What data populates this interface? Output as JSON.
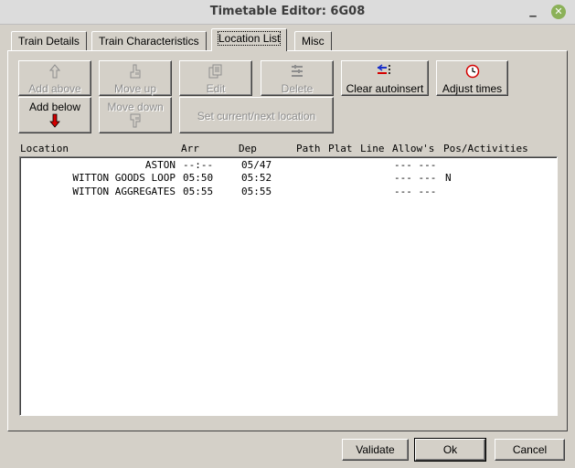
{
  "window": {
    "title": "Timetable Editor: 6G08",
    "minimize_glyph": "_",
    "close_glyph": "✕"
  },
  "tabs": [
    {
      "label": "Train Details",
      "active": false
    },
    {
      "label": "Train Characteristics",
      "active": false
    },
    {
      "label": "Location List",
      "active": true
    },
    {
      "label": "Misc",
      "active": false
    }
  ],
  "toolbar": {
    "add_above": {
      "label": "Add above",
      "icon": "arrow-up-icon",
      "enabled": false
    },
    "move_up": {
      "label": "Move up",
      "icon": "hand-up-icon",
      "enabled": false
    },
    "edit": {
      "label": "Edit",
      "icon": "edit-pages-icon",
      "enabled": false
    },
    "delete": {
      "label": "Delete",
      "icon": "delete-rows-icon",
      "enabled": false
    },
    "clear_autoinsert": {
      "label": "Clear autoinsert",
      "icon": "clear-autoinsert-icon",
      "enabled": true
    },
    "adjust_times": {
      "label": "Adjust times",
      "icon": "clock-icon",
      "enabled": true
    },
    "add_below": {
      "label": "Add below",
      "icon": "arrow-down-red-icon",
      "enabled": true
    },
    "move_down": {
      "label": "Move down",
      "icon": "hand-down-icon",
      "enabled": false
    },
    "set_current": {
      "label": "Set current/next location",
      "enabled": false
    }
  },
  "list": {
    "headers": {
      "location": "Location",
      "arr": "Arr",
      "dep": "Dep",
      "path": "Path",
      "plat": "Plat",
      "line": "Line",
      "allows": "Allow's",
      "pos": "Pos/Activities"
    },
    "rows": [
      {
        "location": "ASTON",
        "arr": "--:--",
        "dep": "05/47",
        "allows": "--- ---",
        "pos": ""
      },
      {
        "location": "WITTON GOODS LOOP",
        "arr": "05:50",
        "dep": "05:52",
        "allows": "--- ---",
        "pos": "N"
      },
      {
        "location": "WITTON AGGREGATES",
        "arr": "05:55",
        "dep": "05:55",
        "allows": "--- ---",
        "pos": ""
      }
    ]
  },
  "footer": {
    "validate": "Validate",
    "ok": "Ok",
    "cancel": "Cancel"
  },
  "colors": {
    "accent_red": "#d40000",
    "accent_blue": "#1a2fc8",
    "close_green": "#8bb158"
  }
}
